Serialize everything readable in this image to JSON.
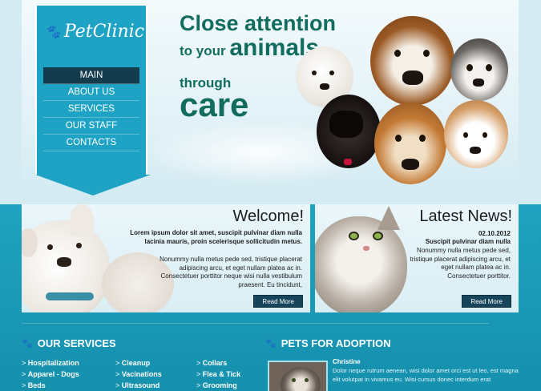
{
  "logo": {
    "icon": "paw-icon",
    "text": "PetClinic"
  },
  "nav": {
    "items": [
      "MAIN",
      "ABOUT US",
      "SERVICES",
      "OUR STAFF",
      "CONTACTS"
    ],
    "active": "MAIN"
  },
  "hero": {
    "line1": "Close attention",
    "line2a": "to your",
    "line2b": "animals",
    "line3": "through",
    "line4": "care"
  },
  "welcome": {
    "title": "Welcome!",
    "bold_text": "Lorem ipsum dolor sit amet, suscipit pulvinar diam nulla lacinia mauris, proin scelerisque sollicitudin metus.",
    "body_text": "Nonummy nulla metus pede sed, tristique placerat adipiscing arcu, et eget nullam platea ac in. Consectetuer porttitor neque wisi nulla vestibulum praesent. Eu tincidunt,",
    "button": "Read More"
  },
  "news": {
    "title": "Latest News!",
    "date": "02.10.2012",
    "bold_text": "Suscipit pulvinar diam nulla",
    "body_text": "Nonummy nulla metus pede sed, tristique placerat adipiscing arcu, et eget nullam platea ac in. Consectetuer porttitor.",
    "button": "Read More"
  },
  "services": {
    "title": "OUR SERVICES",
    "col1": [
      "Hospitalization",
      "Apparel - Dogs",
      "Beds"
    ],
    "col2": [
      "Cleanup",
      "Vacinations",
      "Ultrasound"
    ],
    "col3": [
      "Collars",
      "Flea & Tick",
      "Grooming"
    ]
  },
  "adoption": {
    "title": "PETS FOR ADOPTION",
    "name": "Christine",
    "text": "Dolor neque rutrum aenean, wisi dolor amet orci est ut leo, est magna elit volutpat in vivamus eu. Wisi cursus donec interdum erat"
  },
  "colors": {
    "brand_teal": "#1fa3c4",
    "nav_active": "#153c4d",
    "headline_green": "#136d5e",
    "button_dark": "#16445a"
  }
}
